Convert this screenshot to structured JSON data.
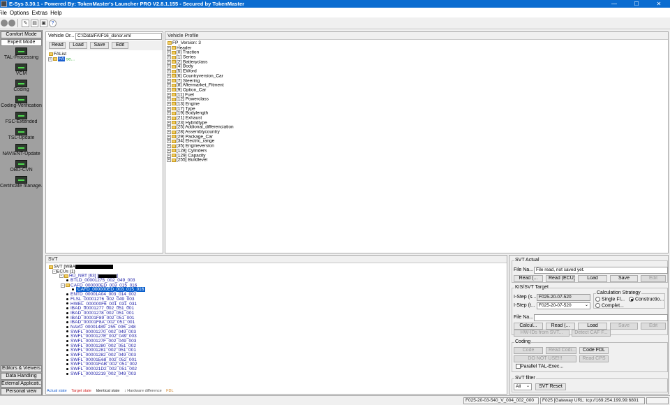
{
  "window": {
    "title": "E-Sys 3.30.1 - Powered By: TokenMaster's Launcher PRO V2.8.1.155 - Secured by TokenMaster",
    "minimize": "—",
    "maximize": "☐",
    "close": "✕"
  },
  "menu": [
    "File",
    "Options",
    "Extras",
    "Help"
  ],
  "sidebar": {
    "top_buttons": [
      "Comfort Mode",
      "Expert Mode"
    ],
    "tools": [
      "TAL-Processing",
      "VCM",
      "Coding",
      "Coding-Verification",
      "FSC-Extended",
      "TSL-Update",
      "NAV/ENT-Update",
      "OBD-CVN",
      "Certificate manage..."
    ],
    "bottom_buttons": [
      "Editors & Viewers",
      "Data Handling",
      "External Applicati...",
      "Personal view"
    ]
  },
  "vehicle_order": {
    "label": "Vehicle Or...",
    "path": "C:\\Data\\FA\\F16_donor.xml",
    "buttons": [
      "Read",
      "Load",
      "Save",
      "Edit"
    ],
    "tree_root": "FAList",
    "tree_item": "FA",
    "tree_item_suffix": "se..."
  },
  "vehicle_profile": {
    "title": "Vehicle Profile",
    "root": "FP_Version: 3",
    "items": [
      "Header",
      "[0] Traction",
      "[1] Series",
      "[2] Batteryclass",
      "[4] Body",
      "[5] EWord",
      "[6] Countryversion_Car",
      "[7] Steering",
      "[8] Aftermarket_Fitment",
      "[9] Option_Car",
      "[11] Fuel",
      "[12] Powerclass",
      "[13] Engine",
      "[17] Type",
      "[19] Bodylength",
      "[21] Exhaust",
      "[23] Hybridtype",
      "[25] Addional_differenciation",
      "[28] Assemblycountry",
      "[29] Package_Car",
      "[34] Electric_range",
      "[35] Engineversion",
      "[128] Cylinders",
      "[129] Capacity",
      "[255] Buildlevel"
    ]
  },
  "svt": {
    "title": "SVT",
    "root_prefix": "SVT [WBA",
    "ecus_label": "ECUs (1)",
    "hu_label": "HU_NBT [63] [",
    "btld": "BTLD_00001275_002_049_003",
    "cafd_parent": "CAFD_000000ED_003_015_016",
    "cafd_selected": "CAFD_000000ED_003_015_016",
    "entries": [
      "ENTD_00001A04_003_014_002",
      "FLSL_00001276_002_049_003",
      "HWEL_000000F6_001_031_031",
      "IBAD_00001277_002_051_001",
      "IBAD_00001278_002_051_001",
      "IBAD_00001F89_002_051_001",
      "IBAD_00001F8A_002_051_001",
      "NAVD_00001489_255_006_248",
      "SWFL_00001270_002_049_003",
      "SWFL_0000127E_002_049_003",
      "SWFL_0000127F_002_049_003",
      "SWFL_00001280_002_051_002",
      "SWFL_00001281_002_051_001",
      "SWFL_00001282_002_049_003",
      "SWFL_00001E68_002_052_001",
      "SWFL_00001FAB_002_051_002",
      "SWFL_000021D2_002_051_002",
      "SWFL_00002219_002_049_003"
    ],
    "legend": [
      "Actual state",
      "Target state",
      "Identical state",
      "↕ Hardware difference",
      "FDL"
    ],
    "legend_colors": [
      "#1a5fd0",
      "#d02020",
      "#202020",
      "#555555",
      "#d08020"
    ]
  },
  "right_panel": {
    "svt_actual": {
      "title": "SVT Actual",
      "file_label": "File Na...",
      "file_value": "File read, not saved yet.",
      "buttons": [
        "Read (...",
        "Read (ECU)",
        "Load",
        "Save",
        "Edit"
      ]
    },
    "kis": {
      "title": "KIS/SVT Target",
      "istep_s_label": "I-Step (s...",
      "istep_s_value": "F025-20-07-520",
      "istep_t_label": "I-Step (t...",
      "istep_t_value": "F025-20-07-520",
      "calc_title": "Calculation Strategy",
      "radio_single": "Single Fl...",
      "radio_construction": "Constructio...",
      "radio_complete": "Complet...",
      "file_label": "File Na...",
      "buttons": [
        "Calcul...",
        "Read (...",
        "Load",
        "Save",
        "Edit"
      ],
      "hw_button": "HW-IDs from SVT...",
      "detect_button": "Detect CAF F..."
    },
    "coding": {
      "title": "Coding",
      "code_button": "Code",
      "read_coding_button": "Read Codi...",
      "code_fdl_button": "Code FDL",
      "do_not_use_button": "DO NOT USE!!!",
      "read_cps_button": "Read CPS",
      "parallel_label": "Parallel TAL-Exec..."
    },
    "filter": {
      "title": "SVT filter",
      "select_value": "All",
      "reset_button": "SVT Reset"
    }
  },
  "statusbar": {
    "istep": "F025-20-03-540_V_004_002_000",
    "connection": "F025 [Gateway URL: tcp://169.254.199.99:6801"
  }
}
